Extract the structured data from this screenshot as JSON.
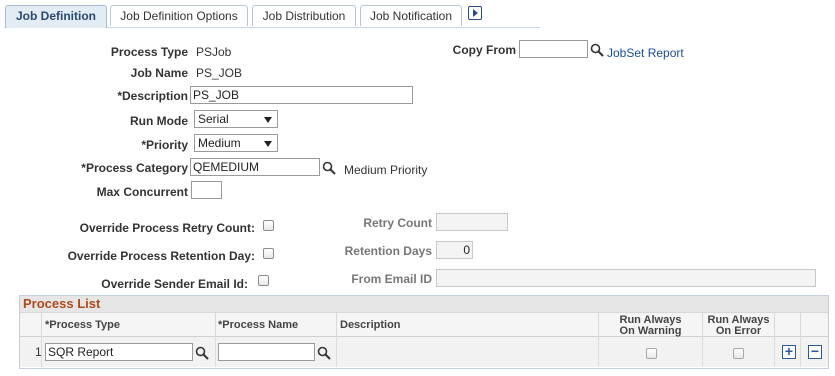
{
  "tabs": [
    {
      "label": "Job Definition",
      "active": true
    },
    {
      "label": "Job Definition Options",
      "active": false
    },
    {
      "label": "Job Distribution",
      "active": false
    },
    {
      "label": "Job Notification",
      "active": false
    }
  ],
  "form": {
    "process_type_label": "Process Type",
    "process_type_value": "PSJob",
    "job_name_label": "Job Name",
    "job_name_value": "PS_JOB",
    "description_label": "*Description",
    "description_value": "PS_JOB",
    "run_mode_label": "Run Mode",
    "run_mode_value": "Serial",
    "priority_label": "*Priority",
    "priority_value": "Medium",
    "process_category_label": "*Process Category",
    "process_category_value": "QEMEDIUM",
    "process_category_desc": "Medium Priority",
    "max_concurrent_label": "Max Concurrent",
    "max_concurrent_value": "",
    "copy_from_label": "Copy From",
    "copy_from_value": "",
    "jobset_report_link": "JobSet Report"
  },
  "overrides": {
    "retry_label": "Override Process Retry Count:",
    "retention_label": "Override Process Retention Day:",
    "sender_label": "Override Sender Email Id:",
    "retry_count_label": "Retry Count",
    "retry_count_value": "",
    "retention_days_label": "Retention Days",
    "retention_days_value": "0",
    "from_email_label": "From Email ID",
    "from_email_value": ""
  },
  "process_list": {
    "title": "Process List",
    "columns": [
      "*Process Type",
      "*Process Name",
      "Description",
      "Run Always On Warning",
      "Run Always On Error"
    ],
    "col_run_warning_l1": "Run Always",
    "col_run_warning_l2": "On Warning",
    "col_run_error_l1": "Run Always",
    "col_run_error_l2": "On Error",
    "rows": [
      {
        "num": "1",
        "process_type": "SQR Report",
        "process_name": "",
        "description": "",
        "run_on_warning": false,
        "run_on_error": false
      }
    ]
  },
  "icons": {
    "lookup": "magnifier-icon",
    "tab_scroll": "play-arrow-icon",
    "add_row": "plus-icon",
    "delete_row": "minus-icon"
  },
  "colors": {
    "accent": "#1a4fa0",
    "grid_title": "#b04a1a",
    "active_tab": "#e3ebf4"
  }
}
